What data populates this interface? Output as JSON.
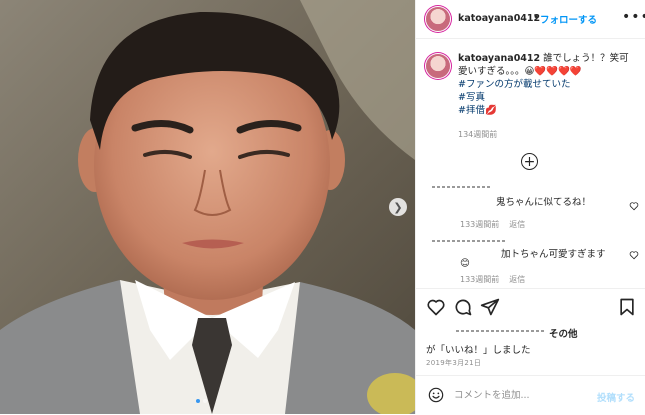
{
  "post": {
    "username": "katoayana0412",
    "header_separator": "•",
    "follow_label": "フォローする",
    "more_label": "•••"
  },
  "caption": {
    "username": "katoayana0412",
    "text": "誰でしょう！？笑可愛いすぎる。。。😀❤️❤️❤️❤️",
    "hashtags": [
      "#ファンの方が載せていた",
      "#写真",
      "#拝借💋"
    ],
    "time": "134週間前"
  },
  "load_more_label": "+",
  "comments": [
    {
      "text": "鬼ちゃんに似てるね！",
      "time": "133週間前",
      "reply_label": "返信"
    },
    {
      "text": "加トちゃん可愛すぎます",
      "emoji": "😊",
      "time": "133週間前",
      "reply_label": "返信"
    }
  ],
  "likes": {
    "others_label": "その他",
    "prefix": "が「いいね！」しました"
  },
  "date": "2019年3月21日",
  "add_comment": {
    "placeholder": "コメントを追加...",
    "post_label": "投稿する"
  },
  "carousel": {
    "current_index": 0,
    "total": 2
  },
  "colors": {
    "link_blue": "#0095f6",
    "post_disabled": "#b2dffc",
    "hashtag": "#00376b",
    "meta_gray": "#8e8e8e"
  }
}
